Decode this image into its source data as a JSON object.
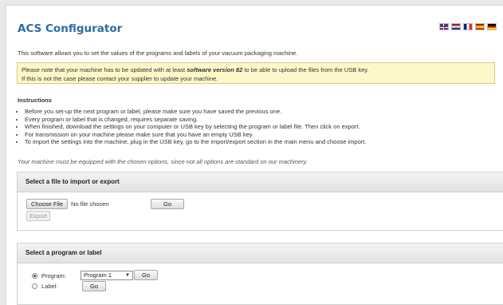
{
  "header": {
    "title": "ACS Configurator",
    "languages": [
      "en-flag-icon",
      "nl-flag-icon",
      "fr-flag-icon",
      "es-flag-icon",
      "de-flag-icon"
    ]
  },
  "intro": "This software allows you to set the values of the programs and labels of your vacuum packaging machine.",
  "notice": {
    "text_before": "Please note that your machine has to be updated with at least ",
    "emphasis": "software version 82",
    "text_after": " to be able to upload the files from the USB key.",
    "line2": "If this is not the case please contact your supplier to update your machine."
  },
  "instructions": {
    "title": "Instructions",
    "items": [
      "Before you set-up the next program or label, please make sure you have saved the previous one.",
      "Every program or label that is changed, requires separate saving.",
      "When finished, download the settings on your computer or USB key by selecting the program or label file. Then click on export.",
      "For transmission on your machine please make sure that you have an empty USB key.",
      "To import the settings into the machine, plug in the USB key, go to the import/export section in the main menu and choose import."
    ]
  },
  "note": "Your machine must be equipped with the chosen options, since not all options are standard on our machinery.",
  "import_export": {
    "heading": "Select a file to import or export",
    "choose_file_label": "Choose File",
    "file_status": "No file chosen",
    "go_label": "Go",
    "export_label": "Export"
  },
  "program_label": {
    "heading": "Select a program or label",
    "program_label": "Program:",
    "program_selected": "Program 1",
    "program_go": "Go",
    "label_label": "Label:",
    "label_go": "Go",
    "selected_option": "Program"
  }
}
